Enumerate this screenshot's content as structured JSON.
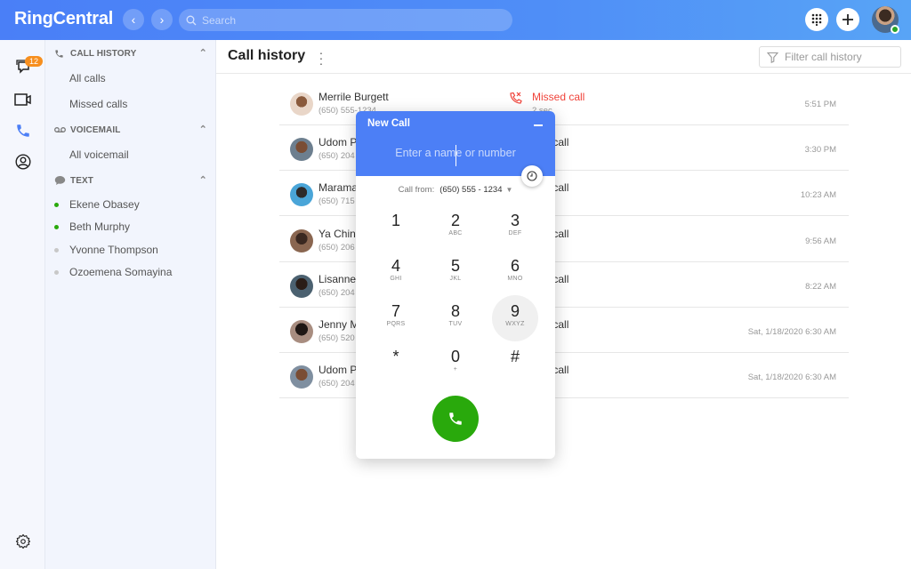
{
  "app": {
    "brand": "RingCentral",
    "search_placeholder": "Search"
  },
  "colors": {
    "accent": "#4c7ff6",
    "missed": "#f0433a",
    "online": "#29a329",
    "badge": "#f78f1e",
    "call_green": "#29a90c"
  },
  "rail": {
    "messages_badge": "12"
  },
  "sidebar": {
    "call_history": {
      "title": "CALL HISTORY",
      "items": [
        "All calls",
        "Missed calls"
      ]
    },
    "voicemail": {
      "title": "VOICEMAIL",
      "items": [
        "All voicemail"
      ]
    },
    "text": {
      "title": "TEXT",
      "items": [
        {
          "name": "Ekene Obasey",
          "status": "online"
        },
        {
          "name": "Beth Murphy",
          "status": "online"
        },
        {
          "name": "Yvonne Thompson",
          "status": "offline"
        },
        {
          "name": "Ozoemena Somayina",
          "status": "offline"
        }
      ]
    }
  },
  "main": {
    "title": "Call history",
    "filter_placeholder": "Filter call history"
  },
  "calls": [
    {
      "name": "Merrile Burgett",
      "number": "(650) 555-1234",
      "type": "Missed call",
      "duration": "2 sec",
      "time": "5:51 PM"
    },
    {
      "name": "Udom P",
      "number": "(650) 204",
      "type": "und call",
      "duration": "",
      "time": "3:30 PM"
    },
    {
      "name": "Marama",
      "number": "(650) 715",
      "type": "und call",
      "duration": "",
      "time": "10:23 AM"
    },
    {
      "name": "Ya Chin",
      "number": "(650) 206",
      "type": "und call",
      "duration": "",
      "time": "9:56 AM"
    },
    {
      "name": "Lisanne",
      "number": "(650) 204",
      "type": "und call",
      "duration": "",
      "time": "8:22 AM"
    },
    {
      "name": "Jenny M",
      "number": "(650) 520",
      "type": "und call",
      "duration": "",
      "time": "Sat, 1/18/2020 6:30 AM"
    },
    {
      "name": "Udom P",
      "number": "(650) 204",
      "type": "und call",
      "duration": "",
      "time": "Sat, 1/18/2020 6:30 AM"
    }
  ],
  "dialer": {
    "title": "New Call",
    "input_placeholder": "Enter a name or number",
    "call_from_label": "Call from:",
    "call_from_value": "(650) 555 - 1234",
    "keys": [
      {
        "d": "1",
        "l": ""
      },
      {
        "d": "2",
        "l": "ABC"
      },
      {
        "d": "3",
        "l": "DEF"
      },
      {
        "d": "4",
        "l": "GHI"
      },
      {
        "d": "5",
        "l": "JKL"
      },
      {
        "d": "6",
        "l": "MNO"
      },
      {
        "d": "7",
        "l": "PQRS"
      },
      {
        "d": "8",
        "l": "TUV"
      },
      {
        "d": "9",
        "l": "WXYZ"
      },
      {
        "d": "*",
        "l": ""
      },
      {
        "d": "0",
        "l": "+"
      },
      {
        "d": "#",
        "l": ""
      }
    ]
  }
}
